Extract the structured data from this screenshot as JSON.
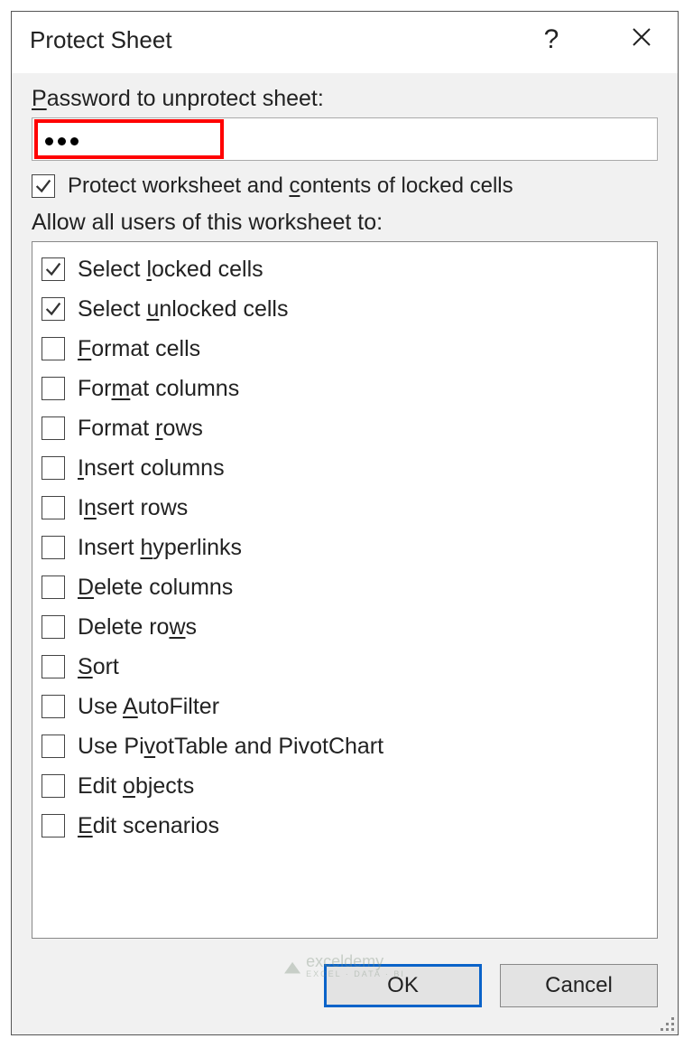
{
  "dialog": {
    "title": "Protect Sheet",
    "password_label_pre": "P",
    "password_label_rest": "assword to unprotect sheet:",
    "password_value": "•••",
    "protect_checkbox": {
      "checked": true,
      "text_pre": "Protect worksheet and ",
      "text_u": "c",
      "text_post": "ontents of locked cells"
    },
    "allow_label": "Allow all users of this worksheet to:",
    "permissions": [
      {
        "checked": true,
        "pre": "Select ",
        "u": "l",
        "post": "ocked cells"
      },
      {
        "checked": true,
        "pre": "Select ",
        "u": "u",
        "post": "nlocked cells"
      },
      {
        "checked": false,
        "pre": "",
        "u": "F",
        "post": "ormat cells"
      },
      {
        "checked": false,
        "pre": "For",
        "u": "m",
        "post": "at columns"
      },
      {
        "checked": false,
        "pre": "Format ",
        "u": "r",
        "post": "ows"
      },
      {
        "checked": false,
        "pre": "",
        "u": "I",
        "post": "nsert columns"
      },
      {
        "checked": false,
        "pre": "I",
        "u": "n",
        "post": "sert rows"
      },
      {
        "checked": false,
        "pre": "Insert ",
        "u": "h",
        "post": "yperlinks"
      },
      {
        "checked": false,
        "pre": "",
        "u": "D",
        "post": "elete columns"
      },
      {
        "checked": false,
        "pre": "Delete ro",
        "u": "w",
        "post": "s"
      },
      {
        "checked": false,
        "pre": "",
        "u": "S",
        "post": "ort"
      },
      {
        "checked": false,
        "pre": "Use ",
        "u": "A",
        "post": "utoFilter"
      },
      {
        "checked": false,
        "pre": "Use Pi",
        "u": "v",
        "post": "otTable and PivotChart"
      },
      {
        "checked": false,
        "pre": "Edit ",
        "u": "o",
        "post": "bjects"
      },
      {
        "checked": false,
        "pre": "",
        "u": "E",
        "post": "dit scenarios"
      }
    ],
    "buttons": {
      "ok": "OK",
      "cancel": "Cancel"
    }
  },
  "watermark": {
    "text": "exceldemy",
    "sub": "EXCEL · DATA · BI"
  }
}
